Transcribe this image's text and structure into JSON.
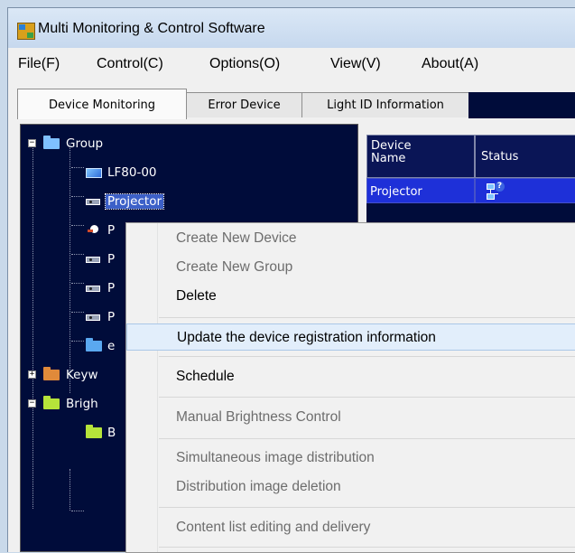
{
  "window": {
    "title": "Multi Monitoring & Control Software"
  },
  "menubar": {
    "items": [
      "File(F)",
      "Control(C)",
      "Options(O)",
      "View(V)",
      "About(A)"
    ]
  },
  "tabs": [
    {
      "label": "Device Monitoring",
      "active": true
    },
    {
      "label": "Error Device",
      "active": false
    },
    {
      "label": "Light ID Information",
      "active": false
    }
  ],
  "tree": {
    "group": {
      "label": "Group"
    },
    "lf80": {
      "label": "LF80-00"
    },
    "projector": {
      "label": "Projector"
    },
    "n3": {
      "label": "P"
    },
    "n4": {
      "label": "P"
    },
    "n5": {
      "label": "P"
    },
    "n6": {
      "label": "P"
    },
    "n7": {
      "label": "e"
    },
    "keyword": {
      "label": "Keyw"
    },
    "brightness": {
      "label": "Brigh"
    },
    "b1": {
      "label": "B"
    }
  },
  "table": {
    "headers": [
      "Device\nName",
      "Status"
    ],
    "rows": [
      {
        "device_name": "Projector",
        "status_icon": "network-unknown-icon"
      }
    ]
  },
  "context_menu": {
    "items": [
      {
        "label": "Create New Device",
        "enabled": false
      },
      {
        "label": "Create New Group",
        "enabled": false
      },
      {
        "label": "Delete",
        "enabled": true
      },
      {
        "label": "Update the device registration information",
        "enabled": true,
        "highlighted": true
      },
      {
        "label": "Schedule",
        "enabled": true
      },
      {
        "label": "Manual Brightness Control",
        "enabled": false
      },
      {
        "label": "Simultaneous image distribution",
        "enabled": false
      },
      {
        "label": "Distribution image deletion",
        "enabled": false
      },
      {
        "label": "Content list editing and delivery",
        "enabled": false
      }
    ]
  },
  "colors": {
    "tree_bg": "#000c3a",
    "row_selected": "#1e30d8",
    "menu_highlight": "#e2eefb"
  }
}
